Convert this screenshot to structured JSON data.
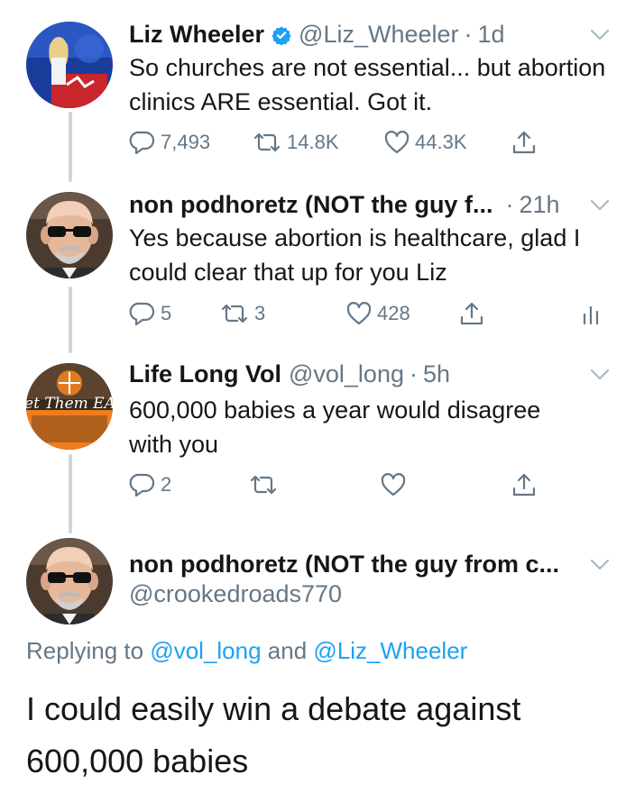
{
  "tweets": [
    {
      "name": "Liz Wheeler",
      "handle": "@Liz_Wheeler",
      "time": "1d",
      "verified": true,
      "text": "So churches are not essential... but abortion clinics ARE essential. Got it.",
      "replies": "7,493",
      "retweets": "14.8K",
      "likes": "44.3K"
    },
    {
      "name": "non podhoretz (NOT the guy f...",
      "time": "21h",
      "text": "Yes because abortion is healthcare, glad I could clear that up for you Liz",
      "replies": "5",
      "retweets": "3",
      "likes": "428"
    },
    {
      "name": "Life Long Vol",
      "handle": "@vol_long",
      "time": "5h",
      "avatar_text": "Let Them EAT",
      "text": "600,000 babies a year would disagree with you",
      "replies": "2"
    },
    {
      "name": "non podhoretz (NOT the guy from c...",
      "handle": "@crookedroads770",
      "replying_prefix": "Replying to",
      "replying_user1": "@vol_long",
      "replying_and": "and",
      "replying_user2": "@Liz_Wheeler",
      "text": "I could easily win a debate against 600,000 babies"
    }
  ],
  "colors": {
    "text": "#14171a",
    "secondary": "#657786",
    "link": "#1da1f2",
    "thread_line": "#ccd6dd"
  },
  "icons": [
    "reply-icon",
    "retweet-icon",
    "like-icon",
    "share-icon",
    "analytics-icon",
    "chevron-down-icon",
    "verified-badge-icon"
  ]
}
